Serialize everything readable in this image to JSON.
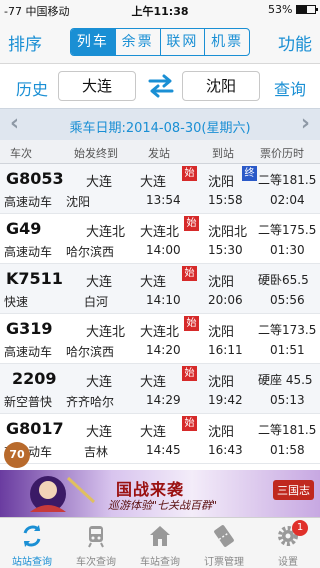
{
  "status_bar": {
    "carrier": "-77 中国移动",
    "time": "上午11:38",
    "battery": "53%",
    "battery_level": 0.53
  },
  "top_bar": {
    "sort_label": "排序",
    "function_label": "功能",
    "segments": [
      "列车",
      "余票",
      "联网",
      "机票"
    ],
    "active_segment": 0
  },
  "search": {
    "history_label": "历史",
    "from_city": "大连",
    "to_city": "沈阳",
    "query_label": "查询"
  },
  "date_bar": {
    "date_text": "乘车日期:2014-08-30(星期六)",
    "prev": "‹",
    "next": "›"
  },
  "columns": [
    "车次",
    "始发终到",
    "发站",
    "到站",
    "票价历时"
  ],
  "trains": [
    {
      "number": "G8053",
      "type": "高速动车",
      "start": "大连",
      "end": "沈阳",
      "from": "大连",
      "from_start": true,
      "to": "沈阳",
      "to_end": true,
      "dep": "13:54",
      "arr": "15:58",
      "seat_price": "二等181.5",
      "duration": "02:04"
    },
    {
      "number": "G49",
      "type": "高速动车",
      "start": "大连北",
      "end": "哈尔滨西",
      "from": "大连北",
      "from_start": true,
      "to": "沈阳北",
      "to_end": false,
      "dep": "14:00",
      "arr": "15:30",
      "seat_price": "二等175.5",
      "duration": "01:30"
    },
    {
      "number": "K7511",
      "type": "快速",
      "start": "大连",
      "end": "白河",
      "from": "大连",
      "from_start": true,
      "to": "沈阳",
      "to_end": false,
      "dep": "14:10",
      "arr": "20:06",
      "seat_price": "硬卧65.5",
      "duration": "05:56"
    },
    {
      "number": "G319",
      "type": "高速动车",
      "start": "大连北",
      "end": "哈尔滨西",
      "from": "大连北",
      "from_start": true,
      "to": "沈阳",
      "to_end": false,
      "dep": "14:20",
      "arr": "16:11",
      "seat_price": "二等173.5",
      "duration": "01:51"
    },
    {
      "number": "2209",
      "type": "新空普快",
      "start": "大连",
      "end": "齐齐哈尔",
      "from": "大连",
      "from_start": true,
      "to": "沈阳",
      "to_end": false,
      "dep": "14:29",
      "arr": "19:42",
      "seat_price": "硬座 45.5",
      "duration": "05:13"
    },
    {
      "number": "G8017",
      "type": "高速动车",
      "start": "大连",
      "end": "吉林",
      "from": "大连",
      "from_start": true,
      "to": "沈阳",
      "to_end": false,
      "dep": "14:45",
      "arr": "16:43",
      "seat_price": "二等181.5",
      "duration": "01:58"
    }
  ],
  "floating_badge": "70",
  "badge_start_glyph": "始",
  "badge_end_glyph": "终",
  "ad_banner": {
    "title": "国战来袭",
    "subtitle": "巡游体验\"七关战百群\"",
    "logo": "三国志"
  },
  "tab_bar": {
    "items": [
      {
        "label": "站站查询",
        "icon": "refresh-arrows-icon",
        "active": true
      },
      {
        "label": "车次查询",
        "icon": "train-icon",
        "active": false
      },
      {
        "label": "车站查询",
        "icon": "station-house-icon",
        "active": false
      },
      {
        "label": "订票管理",
        "icon": "ticket-icon",
        "active": false
      },
      {
        "label": "设置",
        "icon": "gear-icon",
        "active": false,
        "badge": "1"
      }
    ]
  },
  "colors": {
    "accent": "#1a8fd4",
    "start_badge": "#d62a2a",
    "end_badge": "#2a59c8",
    "notification": "#e0302a"
  }
}
